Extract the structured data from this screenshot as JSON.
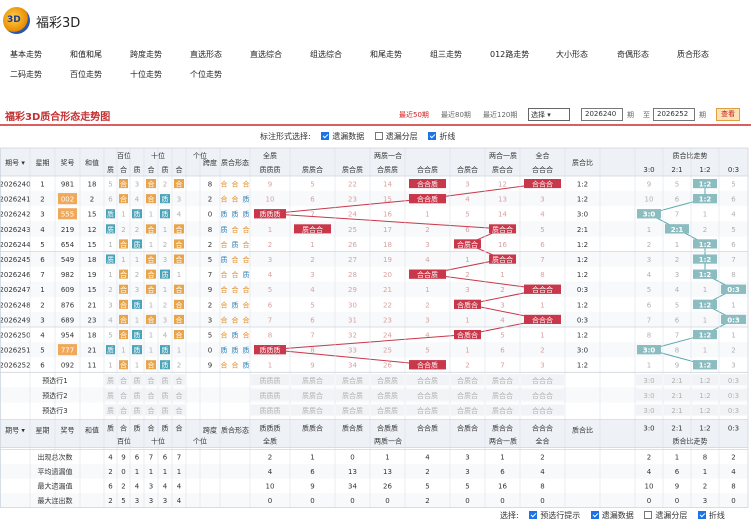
{
  "site": {
    "logo": "3D",
    "title": "福彩3D"
  },
  "nav": {
    "row1": [
      "基本走势",
      "和值和尾",
      "跨度走势",
      "直选形态",
      "直选综合",
      "组选综合",
      "和尾走势",
      "组三走势",
      "012路走势",
      "大小形态",
      "奇偶形态",
      "质合形态"
    ],
    "row2": [
      "二码走势",
      "百位走势",
      "十位走势",
      "个位走势"
    ]
  },
  "section": {
    "title": "福彩3D质合形态走势图",
    "links": [
      "最近50期",
      "最近80期",
      "最近120期"
    ],
    "select": "选择 ▾",
    "from": "2026240",
    "from_label": "期",
    "to_label": "至",
    "to": "2026252",
    "to_suffix": "期",
    "query": "查看"
  },
  "options": {
    "label": "标注形式选择:",
    "items": [
      {
        "label": "遗漏数据",
        "checked": true
      },
      {
        "label": "遗漏分层",
        "checked": false
      },
      {
        "label": "折线",
        "checked": true
      }
    ]
  },
  "headers": {
    "top": [
      "期号 ▾",
      "星期",
      "奖号",
      "和值",
      "百位",
      "十位",
      "个位",
      "跨度",
      "质合形态",
      "全质",
      "两质一合",
      "两合一质",
      "全合",
      "质合比",
      "质合比走势"
    ],
    "zh": [
      "质",
      "合"
    ],
    "full_zhi": "质质质",
    "two_zhi": [
      "质质合",
      "质合质",
      "合质质"
    ],
    "two_he": [
      "合合质",
      "合质合",
      "质合合"
    ],
    "full_he": "合合合",
    "ratios": [
      "3:0",
      "2:1",
      "1:2",
      "0:3"
    ]
  },
  "rows": [
    {
      "p": "2026240",
      "w": "1",
      "n": "981",
      "s": "18",
      "b": [
        "5",
        "合"
      ],
      "t": [
        "3",
        "合"
      ],
      "g": [
        "2",
        "合"
      ],
      "k": "8",
      "f": "合合合",
      "fz": "9",
      "tz": [
        "5",
        "22",
        "14"
      ],
      "th": [
        "合合质",
        "3",
        "12"
      ],
      "fh": "2",
      "r": "1:2",
      "rt": [
        "9",
        "5",
        "1:2",
        "5"
      ]
    },
    {
      "p": "2026241",
      "w": "2",
      "n": "002",
      "s": "2",
      "b": [
        "6",
        "合"
      ],
      "t": [
        "4",
        "合"
      ],
      "g": [
        "质",
        "3"
      ],
      "k": "2",
      "f": "合合质",
      "fz": "10",
      "tz": [
        "6",
        "23",
        "15"
      ],
      "th": [
        "合合质",
        "4",
        "13"
      ],
      "fh": "3",
      "r": "1:2",
      "rt": [
        "10",
        "6",
        "1:2",
        "6"
      ]
    },
    {
      "p": "2026242",
      "w": "3",
      "n": "555",
      "s": "15",
      "b": [
        "质",
        "1"
      ],
      "t": [
        "质",
        "1"
      ],
      "g": [
        "质",
        "4"
      ],
      "k": "0",
      "f": "质质质",
      "fz": "质质质",
      "tz": [
        "7",
        "24",
        "16"
      ],
      "th": [
        "1",
        "5",
        "14"
      ],
      "fh": "4",
      "r": "3:0",
      "rt": [
        "3:0",
        "7",
        "1",
        "4"
      ]
    },
    {
      "p": "2026243",
      "w": "4",
      "n": "219",
      "s": "12",
      "b": [
        "质",
        "2"
      ],
      "t": [
        "2",
        "合"
      ],
      "g": [
        "1",
        "合"
      ],
      "k": "8",
      "f": "质合合",
      "fz": "1",
      "tz": [
        "质合合",
        "25",
        "17"
      ],
      "th": [
        "2",
        "6",
        "15"
      ],
      "fh": "5",
      "r": "2:1",
      "rt": [
        "1",
        "2:1",
        "2",
        "5"
      ]
    },
    {
      "p": "2026244",
      "w": "5",
      "n": "654",
      "s": "15",
      "b": [
        "1",
        "合"
      ],
      "t": [
        "质",
        "1"
      ],
      "g": [
        "2",
        "合"
      ],
      "k": "2",
      "f": "合质合",
      "fz": "2",
      "tz": [
        "1",
        "26",
        "18"
      ],
      "th": [
        "3",
        "合质合",
        "16"
      ],
      "fh": "6",
      "r": "1:2",
      "rt": [
        "2",
        "1",
        "1:2",
        "6"
      ]
    },
    {
      "p": "2026245",
      "w": "6",
      "n": "549",
      "s": "18",
      "b": [
        "质",
        "1"
      ],
      "t": [
        "1",
        "合"
      ],
      "g": [
        "3",
        "合"
      ],
      "k": "5",
      "f": "质合合",
      "fz": "3",
      "tz": [
        "2",
        "27",
        "19"
      ],
      "th": [
        "4",
        "1",
        "质合合"
      ],
      "fh": "7",
      "r": "1:2",
      "rt": [
        "3",
        "2",
        "1:2",
        "7"
      ]
    },
    {
      "p": "2026246",
      "w": "7",
      "n": "982",
      "s": "19",
      "b": [
        "1",
        "合"
      ],
      "t": [
        "2",
        "合"
      ],
      "g": [
        "质",
        "1"
      ],
      "k": "7",
      "f": "合合质",
      "fz": "4",
      "tz": [
        "3",
        "28",
        "20"
      ],
      "th": [
        "合合质",
        "2",
        "1"
      ],
      "fh": "8",
      "r": "1:2",
      "rt": [
        "4",
        "3",
        "1:2",
        "8"
      ]
    },
    {
      "p": "2026247",
      "w": "1",
      "n": "609",
      "s": "15",
      "b": [
        "2",
        "合"
      ],
      "t": [
        "3",
        "合"
      ],
      "g": [
        "1",
        "合"
      ],
      "k": "9",
      "f": "合合合",
      "fz": "5",
      "tz": [
        "4",
        "29",
        "21"
      ],
      "th": [
        "1",
        "3",
        "2"
      ],
      "fh": "合合合",
      "r": "0:3",
      "rt": [
        "5",
        "4",
        "1",
        "0:3"
      ]
    },
    {
      "p": "2026248",
      "w": "2",
      "n": "876",
      "s": "21",
      "b": [
        "3",
        "合"
      ],
      "t": [
        "质",
        "1"
      ],
      "g": [
        "2",
        "合"
      ],
      "k": "2",
      "f": "合质合",
      "fz": "6",
      "tz": [
        "5",
        "30",
        "22"
      ],
      "th": [
        "2",
        "合质合",
        "3"
      ],
      "fh": "1",
      "r": "1:2",
      "rt": [
        "6",
        "5",
        "1:2",
        "1"
      ]
    },
    {
      "p": "2026249",
      "w": "3",
      "n": "689",
      "s": "23",
      "b": [
        "4",
        "合"
      ],
      "t": [
        "1",
        "合"
      ],
      "g": [
        "3",
        "合"
      ],
      "k": "3",
      "f": "合合合",
      "fz": "7",
      "tz": [
        "6",
        "31",
        "23"
      ],
      "th": [
        "3",
        "1",
        "4"
      ],
      "fh": "合合合",
      "r": "0:3",
      "rt": [
        "7",
        "6",
        "1",
        "0:3"
      ]
    },
    {
      "p": "2026250",
      "w": "4",
      "n": "954",
      "s": "18",
      "b": [
        "5",
        "合"
      ],
      "t": [
        "质",
        "1"
      ],
      "g": [
        "4",
        "合"
      ],
      "k": "5",
      "f": "合质合",
      "fz": "8",
      "tz": [
        "7",
        "32",
        "24"
      ],
      "th": [
        "4",
        "合质合",
        "5"
      ],
      "fh": "1",
      "r": "1:2",
      "rt": [
        "8",
        "7",
        "1:2",
        "1"
      ]
    },
    {
      "p": "2026251",
      "w": "5",
      "n": "777",
      "s": "21",
      "b": [
        "质",
        "1"
      ],
      "t": [
        "质",
        "1"
      ],
      "g": [
        "质",
        "1"
      ],
      "k": "0",
      "f": "质质质",
      "fz": "质质质",
      "tz": [
        "8",
        "33",
        "25"
      ],
      "th": [
        "5",
        "1",
        "6"
      ],
      "fh": "2",
      "r": "3:0",
      "rt": [
        "3:0",
        "8",
        "1",
        "2"
      ]
    },
    {
      "p": "2026252",
      "w": "6",
      "n": "092",
      "s": "11",
      "b": [
        "1",
        "合"
      ],
      "t": [
        "1",
        "合"
      ],
      "g": [
        "质",
        "2"
      ],
      "k": "9",
      "f": "合合质",
      "fz": "1",
      "tz": [
        "9",
        "34",
        "26"
      ],
      "th": [
        "合合质",
        "2",
        "7"
      ],
      "fh": "3",
      "r": "1:2",
      "rt": [
        "1",
        "9",
        "1:2",
        "3"
      ]
    }
  ],
  "pre": [
    {
      "label": "预选行1"
    },
    {
      "label": "预选行2"
    },
    {
      "label": "预选行3"
    }
  ],
  "pre_cells": {
    "pos": [
      "质",
      "合",
      "质",
      "合",
      "质",
      "合"
    ],
    "forms": [
      "质质质",
      "质质合",
      "质合质",
      "合质质",
      "合合质",
      "合质合",
      "质合合",
      "合合合"
    ]
  },
  "footer_headers": {
    "row_a": [
      "期号 ▾",
      "星期",
      "奖号",
      "和值",
      "质",
      "合",
      "质",
      "合",
      "质",
      "合",
      "跨度",
      "质合形态",
      "质质质",
      "质质合",
      "质合质",
      "合质质",
      "合合质",
      "合质合",
      "质合合",
      "合合合",
      "质合比",
      "3:0",
      "2:1",
      "1:2",
      "0:3"
    ],
    "row_b": [
      "百位",
      "十位",
      "个位",
      "全质",
      "两质一合",
      "两合一质",
      "全合",
      "质合比走势"
    ]
  },
  "stats": [
    {
      "label": "出现总次数",
      "pos": [
        "4",
        "9",
        "6",
        "7",
        "6",
        "7"
      ],
      "forms": [
        "2",
        "1",
        "0",
        "1",
        "4",
        "3",
        "1",
        "2"
      ],
      "ratio": [
        "2",
        "1",
        "8",
        "2"
      ]
    },
    {
      "label": "平均遗漏值",
      "pos": [
        "2",
        "0",
        "1",
        "1",
        "1",
        "1"
      ],
      "forms": [
        "4",
        "6",
        "13",
        "13",
        "2",
        "3",
        "6",
        "4"
      ],
      "ratio": [
        "4",
        "6",
        "1",
        "4"
      ]
    },
    {
      "label": "最大遗漏值",
      "pos": [
        "6",
        "2",
        "4",
        "3",
        "4",
        "4"
      ],
      "forms": [
        "10",
        "9",
        "34",
        "26",
        "5",
        "5",
        "16",
        "8"
      ],
      "ratio": [
        "10",
        "9",
        "2",
        "8"
      ]
    },
    {
      "label": "最大连出数",
      "pos": [
        "2",
        "5",
        "3",
        "3",
        "3",
        "4"
      ],
      "forms": [
        "0",
        "0",
        "0",
        "0",
        "2",
        "0",
        "0",
        "0"
      ],
      "ratio": [
        "0",
        "0",
        "3",
        "0"
      ]
    }
  ],
  "bottom": {
    "label": "选择:",
    "items": [
      {
        "label": "预选行提示",
        "checked": true
      },
      {
        "label": "遗漏数据",
        "checked": true
      },
      {
        "label": "遗漏分层",
        "checked": false
      },
      {
        "label": "折线",
        "checked": true
      }
    ]
  }
}
